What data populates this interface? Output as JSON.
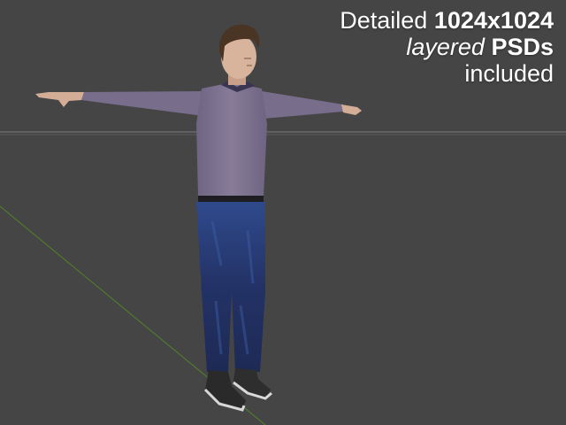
{
  "viewport": {
    "background": "#454545",
    "horizon_color": "#6a6a6a",
    "axis_color": "#4f7a2e"
  },
  "caption": {
    "line1_prefix": "Detailed ",
    "line1_bold": "1024x1024",
    "line2_italic": "layered",
    "line2_bold": "PSDs",
    "line3": "included"
  },
  "model": {
    "name": "t-pose character",
    "shirt_color": "#7d728f",
    "jeans_color": "#2b3d78",
    "skin_color": "#d4ad96",
    "hair_color": "#4a3424",
    "shoe_color": "#2a2a2a"
  }
}
